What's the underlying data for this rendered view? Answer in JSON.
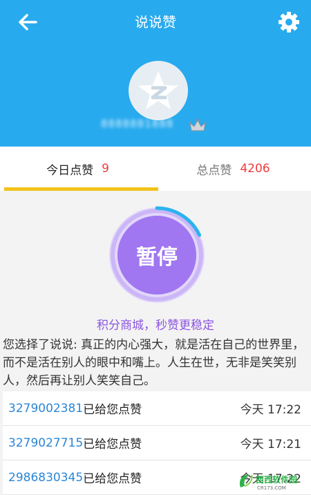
{
  "header": {
    "title": "说说赞",
    "nickname": "8888881888",
    "bg_color": "#28aaee"
  },
  "icons": {
    "back": "arrow-left-icon",
    "settings": "gear-icon",
    "avatar": "qzone-star-icon",
    "crown": "crown-icon"
  },
  "tabs": [
    {
      "label": "今日点赞",
      "count": "9",
      "active": true
    },
    {
      "label": "总点赞",
      "count": "4206",
      "active": false
    }
  ],
  "action": {
    "button_label": "暂停",
    "progress": 0.18
  },
  "promo_text": "积分商城，秒赞更稳定",
  "selected_post": "您选择了说说: 真正的内心强大，就是活在自己的世界里，而不是活在别人的眼中和嘴上。人生在世，无非是笑笑别人，然后再让别人笑笑自己。",
  "likes": [
    {
      "qq": "3279002381",
      "message": "已给您点赞",
      "time": "今天 17:22"
    },
    {
      "qq": "3279027715",
      "message": "已给您点赞",
      "time": "今天 17:21"
    },
    {
      "qq": "2986830345",
      "message": "已给您点赞",
      "time": "今天 17:22"
    }
  ],
  "watermark": {
    "line1": "西西软件园",
    "line2": "CR173.COM"
  }
}
